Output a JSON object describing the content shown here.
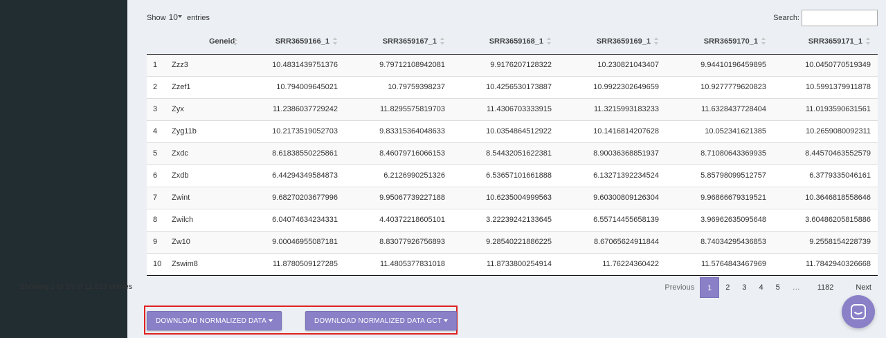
{
  "controls": {
    "show_label": "Show",
    "entries_value": "10",
    "entries_label": "entries",
    "search_label": "Search:",
    "search_value": ""
  },
  "table": {
    "columns": [
      "",
      "Geneid",
      "SRR3659166_1",
      "SRR3659167_1",
      "SRR3659168_1",
      "SRR3659169_1",
      "SRR3659170_1",
      "SRR3659171_1"
    ],
    "rows": [
      [
        "1",
        "Zzz3",
        "10.4831439751376",
        "9.79712108942081",
        "9.9176207128322",
        "10.230821043407",
        "9.94410196459895",
        "10.0450770519349"
      ],
      [
        "2",
        "Zzef1",
        "10.794009645021",
        "10.79759398237",
        "10.4256530173887",
        "10.9922302649659",
        "10.9277779620823",
        "10.5991379911878"
      ],
      [
        "3",
        "Zyx",
        "11.2386037729242",
        "11.8295575819703",
        "11.4306703333915",
        "11.3215993183233",
        "11.6328437728404",
        "11.0193590631561"
      ],
      [
        "4",
        "Zyg11b",
        "10.2173519052703",
        "9.83315364048633",
        "10.0354864512922",
        "10.1416814207628",
        "10.052341621385",
        "10.2659080092311"
      ],
      [
        "5",
        "Zxdc",
        "8.61838550225861",
        "8.46079716066153",
        "8.54432051622381",
        "8.90036368851937",
        "8.71080643369935",
        "8.44570463552579"
      ],
      [
        "6",
        "Zxdb",
        "6.44294349584873",
        "6.2126990251326",
        "6.53657101661888",
        "6.13271392234524",
        "5.85798099512757",
        "6.3779335046161"
      ],
      [
        "7",
        "Zwint",
        "9.68270203677996",
        "9.95067739227188",
        "10.6235004999563",
        "9.60300809126304",
        "9.96866679319521",
        "10.3646818558646"
      ],
      [
        "8",
        "Zwilch",
        "6.04074634234331",
        "4.40372218605101",
        "3.22239242133645",
        "6.55714455658139",
        "3.96962635095648",
        "3.60486205815886"
      ],
      [
        "9",
        "Zw10",
        "9.00046955087181",
        "8.83077926756893",
        "9.28540221886225",
        "8.67065624911844",
        "8.74034295436853",
        "9.2558154228739"
      ],
      [
        "10",
        "Zswim8",
        "11.8780509127285",
        "11.4805377831018",
        "11.8733800254914",
        "11.76224360422",
        "11.5764843467969",
        "11.7842940326668"
      ]
    ]
  },
  "footer": {
    "info": "Showing 1 to 10 of 11,813 entries",
    "pagination": {
      "previous": "Previous",
      "pages": [
        "1",
        "2",
        "3",
        "4",
        "5"
      ],
      "ellipsis": "…",
      "last": "1182",
      "next": "Next",
      "current": "1"
    }
  },
  "downloads": {
    "normalized_label": "DOWNLOAD NORMALIZED DATA",
    "normalized_gct_label": "DOWNLOAD NORMALIZED DATA GCT"
  },
  "icons": {
    "chat": "chat-bubble-icon",
    "sort": "sort-arrows-icon",
    "dropdown": "caret-down-icon"
  },
  "colors": {
    "accent": "#8a80c8",
    "sidebar": "#222d32",
    "background": "#ecf0f5",
    "highlight_border": "#e02020"
  }
}
